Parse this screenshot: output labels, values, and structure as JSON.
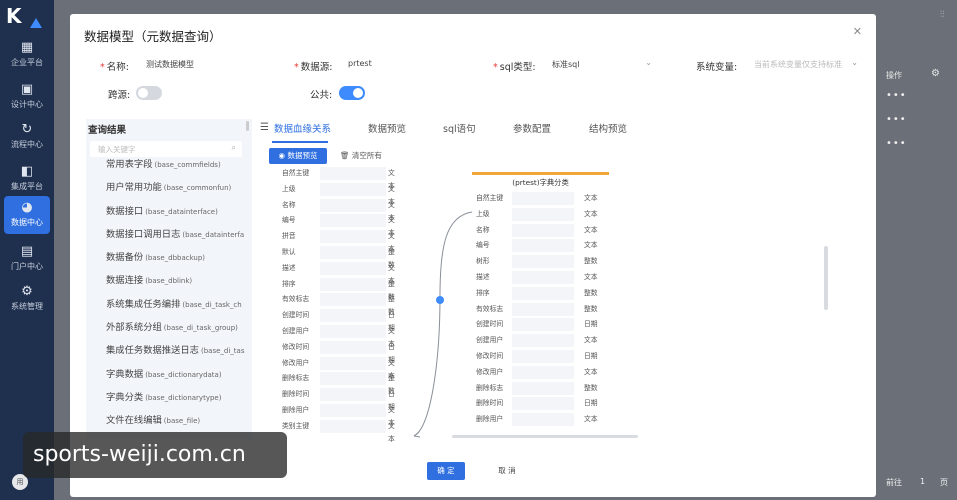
{
  "nav": {
    "logo_text": "K",
    "items": [
      {
        "label": "企业平台",
        "icon": "apps-icon"
      },
      {
        "label": "设计中心",
        "icon": "design-icon"
      },
      {
        "label": "流程中心",
        "icon": "flow-icon"
      },
      {
        "label": "集成平台",
        "icon": "integration-icon"
      },
      {
        "label": "数据中心",
        "icon": "data-icon",
        "active": true
      },
      {
        "label": "门户中心",
        "icon": "portal-icon"
      },
      {
        "label": "系统管理",
        "icon": "system-icon"
      }
    ],
    "avatar_text": "用"
  },
  "background": {
    "column_header": "操作",
    "row_actions": [
      "•••",
      "•••",
      "•••"
    ],
    "pager_prefix": "前往",
    "pager_value": "1",
    "pager_suffix": "页"
  },
  "modal": {
    "title": "数据模型（元数据查询）",
    "form": {
      "name_label": "名称:",
      "name_value": "测试数据模型",
      "datasource_label": "数据源:",
      "datasource_value": "prtest",
      "sqltype_label": "sql类型:",
      "sqltype_value": "标准sql",
      "sysvar_label": "系统变量:",
      "sysvar_placeholder": "当前系统变量仅支持标准",
      "cross_label": "跨源:",
      "cross_on": false,
      "public_label": "公共:",
      "public_on": true
    },
    "query": {
      "title": "查询结果",
      "search_placeholder": "输入关键字",
      "items": [
        {
          "name": "常用表字段",
          "code": "(base_commfields)"
        },
        {
          "name": "用户常用功能",
          "code": "(base_commonfun)"
        },
        {
          "name": "数据接口",
          "code": "(base_datainterface)"
        },
        {
          "name": "数据接口调用日志",
          "code": "(base_datainterfa"
        },
        {
          "name": "数据备份",
          "code": "(base_dbbackup)"
        },
        {
          "name": "数据连接",
          "code": "(base_dblink)"
        },
        {
          "name": "系统集成任务编排",
          "code": "(base_di_task_ch"
        },
        {
          "name": "外部系统分组",
          "code": "(base_di_task_group)"
        },
        {
          "name": "集成任务数据推送日志",
          "code": "(base_di_tas"
        },
        {
          "name": "字典数据",
          "code": "(base_dictionarydata)"
        },
        {
          "name": "字典分类",
          "code": "(base_dictionarytype)"
        },
        {
          "name": "文件在线编辑",
          "code": "(base_file)"
        }
      ]
    },
    "tabs": [
      "数据血缘关系",
      "数据预览",
      "sql语句",
      "参数配置",
      "结构预览"
    ],
    "preview_button": "数据预览",
    "clear_button": "清空所有",
    "source_fields": [
      {
        "name": "自然主键",
        "type": "文本"
      },
      {
        "name": "上级",
        "type": "文本"
      },
      {
        "name": "名称",
        "type": "文本"
      },
      {
        "name": "编号",
        "type": "文本"
      },
      {
        "name": "拼音",
        "type": "文本"
      },
      {
        "name": "默认",
        "type": "整数"
      },
      {
        "name": "描述",
        "type": "文本"
      },
      {
        "name": "排序",
        "type": "整数"
      },
      {
        "name": "有效标志",
        "type": "整数"
      },
      {
        "name": "创建时间",
        "type": "日期"
      },
      {
        "name": "创建用户",
        "type": "文本"
      },
      {
        "name": "修改时间",
        "type": "日期"
      },
      {
        "name": "修改用户",
        "type": "文本"
      },
      {
        "name": "删除标志",
        "type": "整数"
      },
      {
        "name": "删除时间",
        "type": "日期"
      },
      {
        "name": "删除用户",
        "type": "文本"
      },
      {
        "name": "类别主键",
        "type": "文本"
      }
    ],
    "table_card": {
      "title": "(prtest)字典分类",
      "fields": [
        {
          "name": "自然主键",
          "type": "文本"
        },
        {
          "name": "上级",
          "type": "文本"
        },
        {
          "name": "名称",
          "type": "文本"
        },
        {
          "name": "编号",
          "type": "文本"
        },
        {
          "name": "树形",
          "type": "整数"
        },
        {
          "name": "描述",
          "type": "文本"
        },
        {
          "name": "排序",
          "type": "整数"
        },
        {
          "name": "有效标志",
          "type": "整数"
        },
        {
          "name": "创建时间",
          "type": "日期"
        },
        {
          "name": "创建用户",
          "type": "文本"
        },
        {
          "name": "修改时间",
          "type": "日期"
        },
        {
          "name": "修改用户",
          "type": "文本"
        },
        {
          "name": "删除标志",
          "type": "整数"
        },
        {
          "name": "删除时间",
          "type": "日期"
        },
        {
          "name": "删除用户",
          "type": "文本"
        }
      ]
    },
    "ok_button": "确 定",
    "cancel_button": "取 消"
  },
  "watermark": "sports-weiji.com.cn"
}
